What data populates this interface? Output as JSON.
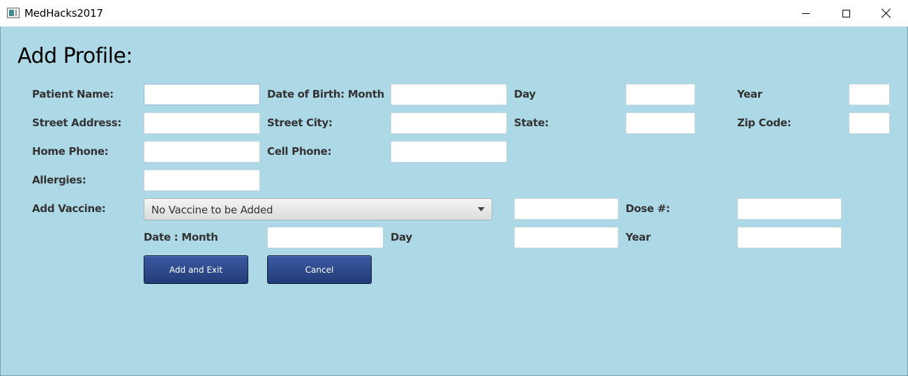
{
  "window": {
    "title": "MedHacks2017",
    "icon": "app-window-icon"
  },
  "form": {
    "heading": "Add Profile:",
    "labels": {
      "patient_name": "Patient Name:",
      "dob_month": "Date of Birth: Month",
      "dob_day": "Day",
      "dob_year": "Year",
      "street_address": "Street Address:",
      "street_city": "Street City:",
      "state": "State:",
      "zip_code": "Zip Code:",
      "home_phone": "Home Phone:",
      "cell_phone": "Cell Phone:",
      "allergies": "Allergies:",
      "add_vaccine": "Add Vaccine:",
      "dose": "Dose #:",
      "vac_date_month": "Date : Month",
      "vac_date_day": "Day",
      "vac_date_year": "Year"
    },
    "values": {
      "patient_name": "",
      "dob_month": "",
      "dob_day": "",
      "dob_year": "",
      "street_address": "",
      "street_city": "",
      "state": "",
      "zip_code": "",
      "home_phone": "",
      "cell_phone": "",
      "allergies": "",
      "vaccine_extra": "",
      "dose": "",
      "vac_date_month": "",
      "vac_date_day": "",
      "vac_date_year": ""
    },
    "vaccine_select": {
      "selected": "No Vaccine to be Added"
    },
    "buttons": {
      "add_exit": "Add and Exit",
      "cancel": "Cancel"
    }
  },
  "colors": {
    "background": "#add8e6",
    "button": "#2a4585"
  }
}
